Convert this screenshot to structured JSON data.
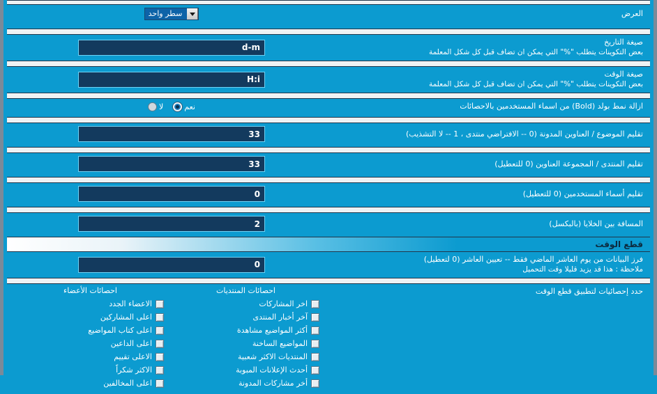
{
  "theme": {
    "panel_bg": "#0c9bd0",
    "separator": "#eef2f4",
    "input_bg": "#133a5e",
    "input_border": "#6fd2f5",
    "frame": "#7a8a99",
    "header_text": "#0c2b3f"
  },
  "rows": {
    "display": {
      "label": "العرض",
      "desc": "",
      "select_value": "سطر واحد"
    },
    "date_format": {
      "label": "صيغة التاريخ",
      "desc": "بعض التكوينات يتطلب  \"%\"  التي يمكن ان تضاف قبل كل شكل المعلمة",
      "value": "d-m"
    },
    "time_format": {
      "label": "صيغة الوقت",
      "desc": "بعض التكوينات يتطلب  \"%\"  التي يمكن ان تضاف قبل كل شكل المعلمة",
      "value": "H:i"
    },
    "remove_bold": {
      "label": "ازالة نمط بولد (Bold) من اسماء المستخدمين بالاحصائات",
      "yes": "نعم",
      "no": "لا",
      "selected": "yes"
    },
    "trim_topic": {
      "label": "تقليم الموضوع / العناوين المدونة (0 -- الافتراضي منتدى ، 1 -- لا التشذيب)",
      "value": "33"
    },
    "trim_forum": {
      "label": "تقليم المنتدى / المجموعة العناوين (0 للتعطيل)",
      "value": "33"
    },
    "trim_usernames": {
      "label": "تقليم أسماء المستخدمين (0 للتعطيل)",
      "value": "0"
    },
    "cell_spacing": {
      "label": "المسافة بين الخلايا (بالبكسل)",
      "value": "2"
    }
  },
  "time_cut_section": {
    "title": "قطع الوقت",
    "sort_days": {
      "label": "فرز البيانات من يوم العاشر الماضي فقط -- تعيين العاشر (0 لتعطيل)",
      "desc": "ملاحظة : هذا قد يزيد قليلا وقت التحميل",
      "value": "0"
    },
    "apply_stats": {
      "label": "حدد إحصائيات لتطبيق قطع الوقت",
      "columns": [
        {
          "key": "forums",
          "title": "احصائات المنتديات",
          "items": [
            {
              "label": "اخر المشاركات",
              "checked": false
            },
            {
              "label": "آخر أخبار المنتدى",
              "checked": false
            },
            {
              "label": "أكثر المواضيع مشاهدة",
              "checked": false
            },
            {
              "label": "المواضيع الساخنة",
              "checked": false
            },
            {
              "label": "المنتديات الاكثر شعبية",
              "checked": false
            },
            {
              "label": "أحدث الإعلانات المبوبة",
              "checked": false
            },
            {
              "label": "أخر مشاركات المدونة",
              "checked": false
            }
          ]
        },
        {
          "key": "members",
          "title": "احصائات الأعضاء",
          "items": [
            {
              "label": "الاعضاء الجدد",
              "checked": false
            },
            {
              "label": "اعلى المشاركين",
              "checked": false
            },
            {
              "label": "اعلى كتاب المواضيع",
              "checked": false
            },
            {
              "label": "اعلى الداعين",
              "checked": false
            },
            {
              "label": "الاعلى تقييم",
              "checked": false
            },
            {
              "label": "الاكثر شكراً",
              "checked": false
            },
            {
              "label": "اعلى المخالفين",
              "checked": false
            }
          ]
        }
      ]
    }
  }
}
